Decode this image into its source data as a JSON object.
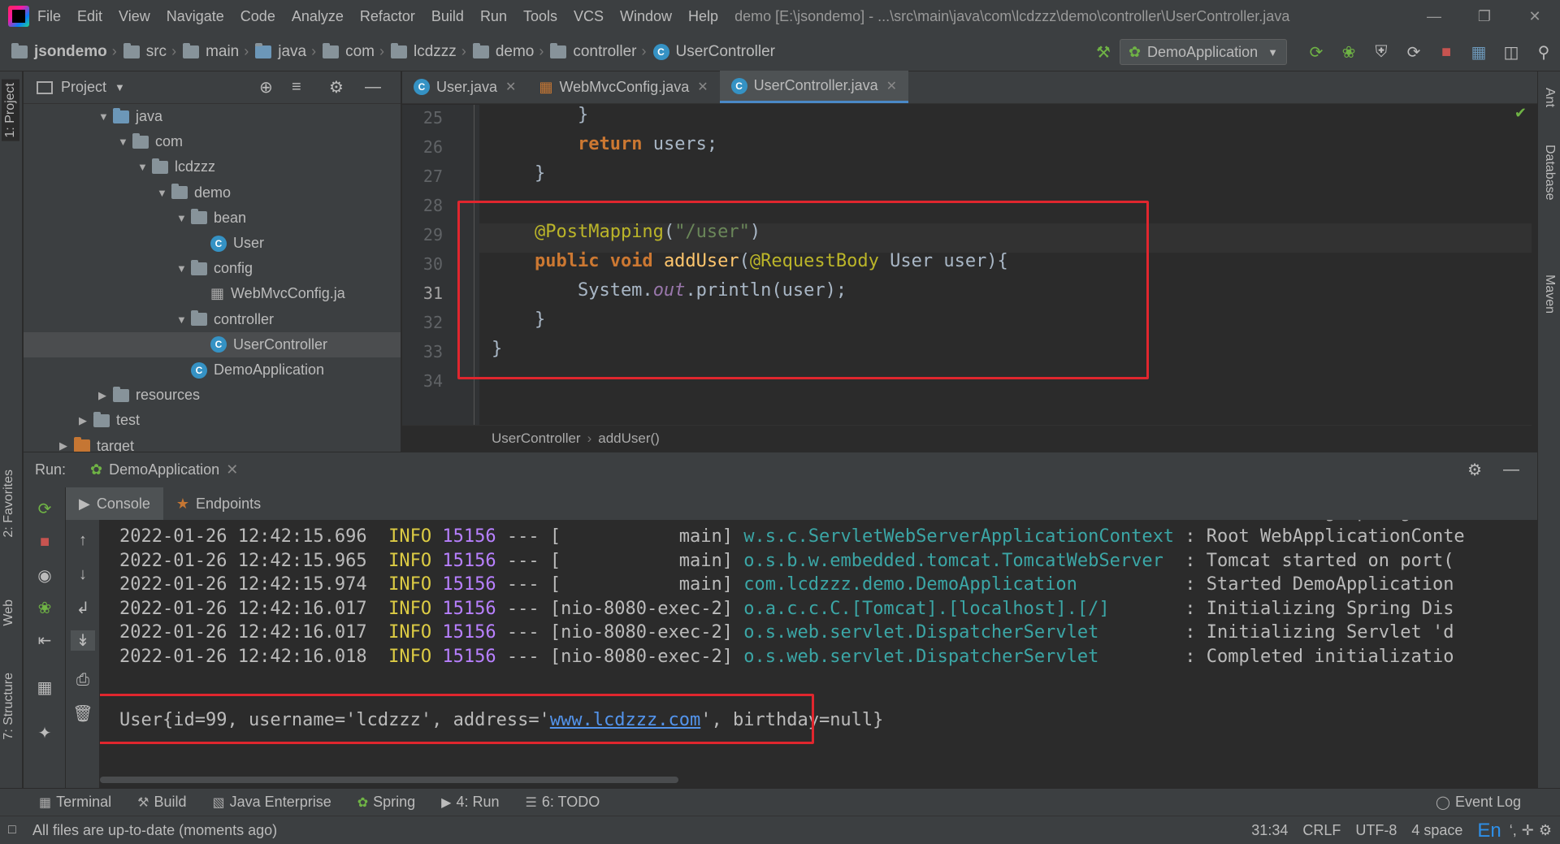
{
  "window": {
    "menu": [
      "File",
      "Edit",
      "View",
      "Navigate",
      "Code",
      "Analyze",
      "Refactor",
      "Build",
      "Run",
      "Tools",
      "VCS",
      "Window",
      "Help"
    ],
    "title": "demo [E:\\jsondemo] - ...\\src\\main\\java\\com\\lcdzzz\\demo\\controller\\UserController.java"
  },
  "breadcrumb": [
    "jsondemo",
    "src",
    "main",
    "java",
    "com",
    "lcdzzz",
    "demo",
    "controller",
    "UserController"
  ],
  "run_config": "DemoApplication",
  "left_strip": [
    "1: Project",
    "2: Favorites",
    "Web",
    "7: Structure"
  ],
  "right_strip": [
    "Ant",
    "Database",
    "Maven"
  ],
  "project_panel": {
    "title": "Project",
    "tree": [
      {
        "label": "java",
        "indent": 3,
        "kind": "folder-blue",
        "arrow": "open"
      },
      {
        "label": "com",
        "indent": 4,
        "kind": "folder",
        "arrow": "open"
      },
      {
        "label": "lcdzzz",
        "indent": 5,
        "kind": "folder",
        "arrow": "open"
      },
      {
        "label": "demo",
        "indent": 6,
        "kind": "folder",
        "arrow": "open"
      },
      {
        "label": "bean",
        "indent": 7,
        "kind": "folder",
        "arrow": "open"
      },
      {
        "label": "User",
        "indent": 8,
        "kind": "class"
      },
      {
        "label": "config",
        "indent": 7,
        "kind": "folder",
        "arrow": "open"
      },
      {
        "label": "WebMvcConfig.ja",
        "indent": 8,
        "kind": "file"
      },
      {
        "label": "controller",
        "indent": 7,
        "kind": "folder",
        "arrow": "open"
      },
      {
        "label": "UserController",
        "indent": 8,
        "kind": "class",
        "selected": true
      },
      {
        "label": "DemoApplication",
        "indent": 7,
        "kind": "spring"
      },
      {
        "label": "resources",
        "indent": 3,
        "kind": "folder",
        "arrow": "closed"
      },
      {
        "label": "test",
        "indent": 2,
        "kind": "folder",
        "arrow": "closed"
      },
      {
        "label": "target",
        "indent": 1,
        "kind": "folder-orange",
        "arrow": "closed"
      }
    ]
  },
  "editor_tabs": [
    {
      "label": "User.java",
      "active": false
    },
    {
      "label": "WebMvcConfig.java",
      "active": false
    },
    {
      "label": "UserController.java",
      "active": true
    }
  ],
  "editor": {
    "line_numbers": [
      "25",
      "26",
      "27",
      "28",
      "29",
      "30",
      "31",
      "32",
      "33",
      "34"
    ],
    "current_line": "31",
    "breadcrumb": [
      "UserController",
      "addUser()"
    ]
  },
  "run_panel": {
    "label": "Run:",
    "config": "DemoApplication",
    "tabs": [
      "Console",
      "Endpoints"
    ],
    "logs": [
      {
        "ts": "2022-01-26 12:42:15.696",
        "level": "INFO",
        "pid": "15156",
        "sep": "---",
        "thread": "[           main]",
        "logger": "w.s.c.ServletWebServerApplicationContext",
        "msg": ": Root WebApplicationConte"
      },
      {
        "ts": "2022-01-26 12:42:15.965",
        "level": "INFO",
        "pid": "15156",
        "sep": "---",
        "thread": "[           main]",
        "logger": "o.s.b.w.embedded.tomcat.TomcatWebServer ",
        "msg": ": Tomcat started on port("
      },
      {
        "ts": "2022-01-26 12:42:15.974",
        "level": "INFO",
        "pid": "15156",
        "sep": "---",
        "thread": "[           main]",
        "logger": "com.lcdzzz.demo.DemoApplication         ",
        "msg": ": Started DemoApplication"
      },
      {
        "ts": "2022-01-26 12:42:16.017",
        "level": "INFO",
        "pid": "15156",
        "sep": "---",
        "thread": "[nio-8080-exec-2]",
        "logger": "o.a.c.c.C.[Tomcat].[localhost].[/]      ",
        "msg": ": Initializing Spring Dis"
      },
      {
        "ts": "2022-01-26 12:42:16.017",
        "level": "INFO",
        "pid": "15156",
        "sep": "---",
        "thread": "[nio-8080-exec-2]",
        "logger": "o.s.web.servlet.DispatcherServlet       ",
        "msg": ": Initializing Servlet 'd"
      },
      {
        "ts": "2022-01-26 12:42:16.018",
        "level": "INFO",
        "pid": "15156",
        "sep": "---",
        "thread": "[nio-8080-exec-2]",
        "logger": "o.s.web.servlet.DispatcherServlet       ",
        "msg": ": Completed initializatio"
      }
    ],
    "output": {
      "before": "User{id=99, username='lcdzzz', address='",
      "link": "www.lcdzzz.com",
      "after": "', birthday=null}"
    }
  },
  "bottom_tabs": [
    "Terminal",
    "Build",
    "Java Enterprise",
    "Spring",
    "4: Run",
    "6: TODO"
  ],
  "event_log": "Event Log",
  "status": {
    "message": "All files are up-to-date (moments ago)",
    "position": "31:34",
    "line_sep": "CRLF",
    "encoding": "UTF-8",
    "indent": "4 space",
    "ime": "En"
  },
  "colors": {
    "accent": "#4a88c7",
    "highlight_box": "#e0262e",
    "keyword": "#cc7832",
    "annotation": "#bbb529",
    "string": "#6a8759",
    "method": "#ffc66d"
  }
}
